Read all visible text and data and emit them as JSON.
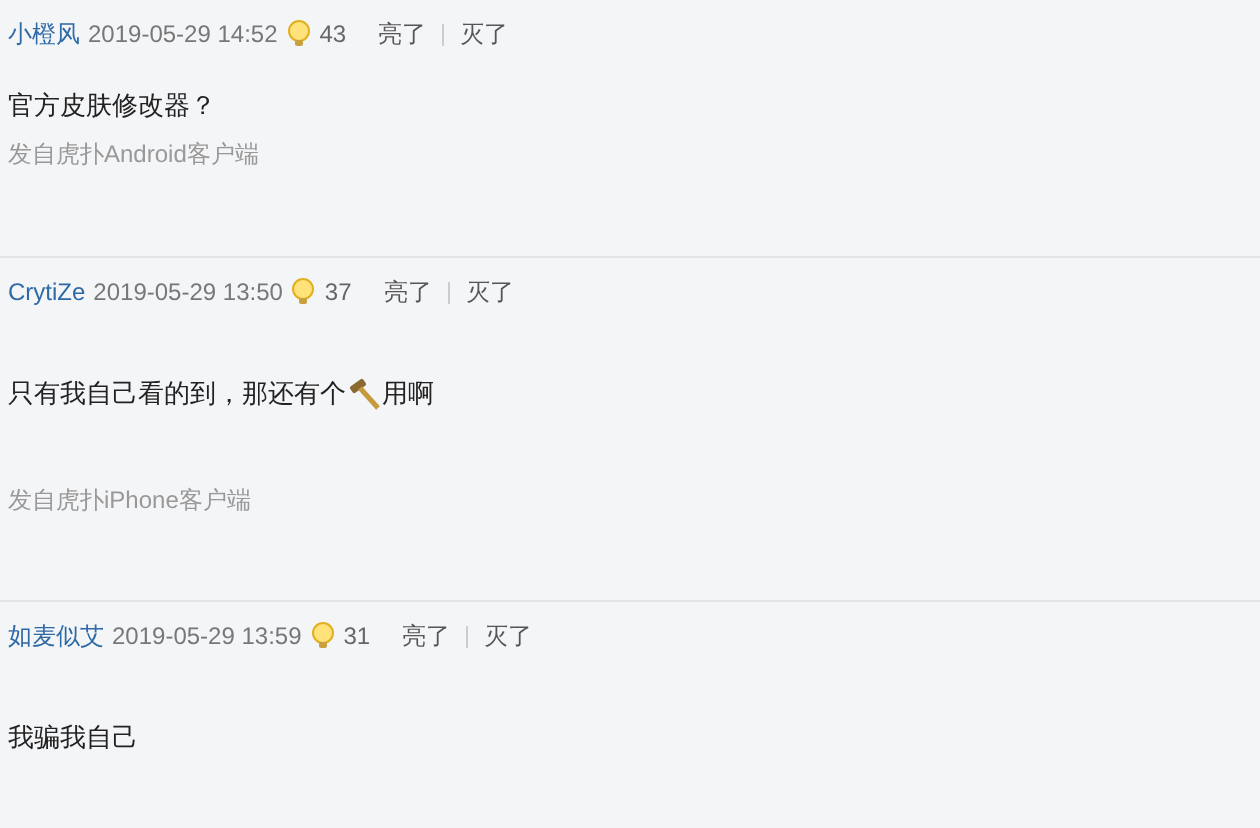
{
  "comments": [
    {
      "user": "小橙风",
      "time": "2019-05-29 14:52",
      "likes": "43",
      "up": "亮了",
      "down": "灭了",
      "body": [
        {
          "kind": "text",
          "text": "官方皮肤修改器？"
        }
      ],
      "source": "发自虎扑Android客户端"
    },
    {
      "user": "CrytiZe",
      "time": "2019-05-29 13:50",
      "likes": "37",
      "up": "亮了",
      "down": "灭了",
      "body": [
        {
          "kind": "text",
          "text": "只有我自己看的到，那还有个"
        },
        {
          "kind": "hammer"
        },
        {
          "kind": "text",
          "text": "用啊"
        }
      ],
      "source": "发自虎扑iPhone客户端"
    },
    {
      "user": "如麦似艾",
      "time": "2019-05-29 13:59",
      "likes": "31",
      "up": "亮了",
      "down": "灭了",
      "body": [
        {
          "kind": "text",
          "text": "我骗我自己"
        }
      ]
    }
  ]
}
